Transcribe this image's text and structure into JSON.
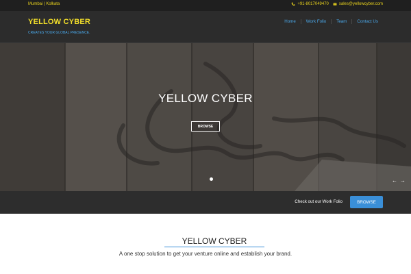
{
  "topbar": {
    "location": "Mumbai | Kolkata",
    "phone": "+91-8017049470",
    "email": "sales@yellowcyber.com",
    "phone_icon": "phone-icon",
    "email_icon": "envelope-icon"
  },
  "header": {
    "brand": "YELLOW CYBER",
    "tagline": "CREATES YOUR GLOBAL PRESENCE."
  },
  "nav": {
    "items": [
      {
        "label": "Home"
      },
      {
        "label": "Work Folio"
      },
      {
        "label": "Team"
      },
      {
        "label": "Contact Us"
      }
    ]
  },
  "hero": {
    "title": "YELLOW CYBER",
    "button": "BROWSE",
    "prev_icon": "arrow-left-icon",
    "next_icon": "arrow-right-icon"
  },
  "cta": {
    "text": "Check out our Work Folio",
    "button": "BROWSE"
  },
  "intro": {
    "title": "YELLOW CYBER",
    "subtitle": "A one stop solution to get your venture online and establish your brand."
  },
  "colors": {
    "brand_yellow": "#f3df2a",
    "link_blue": "#4aa7e8",
    "button_blue": "#3a8fd8",
    "dark_bg": "#2c2c2c"
  }
}
